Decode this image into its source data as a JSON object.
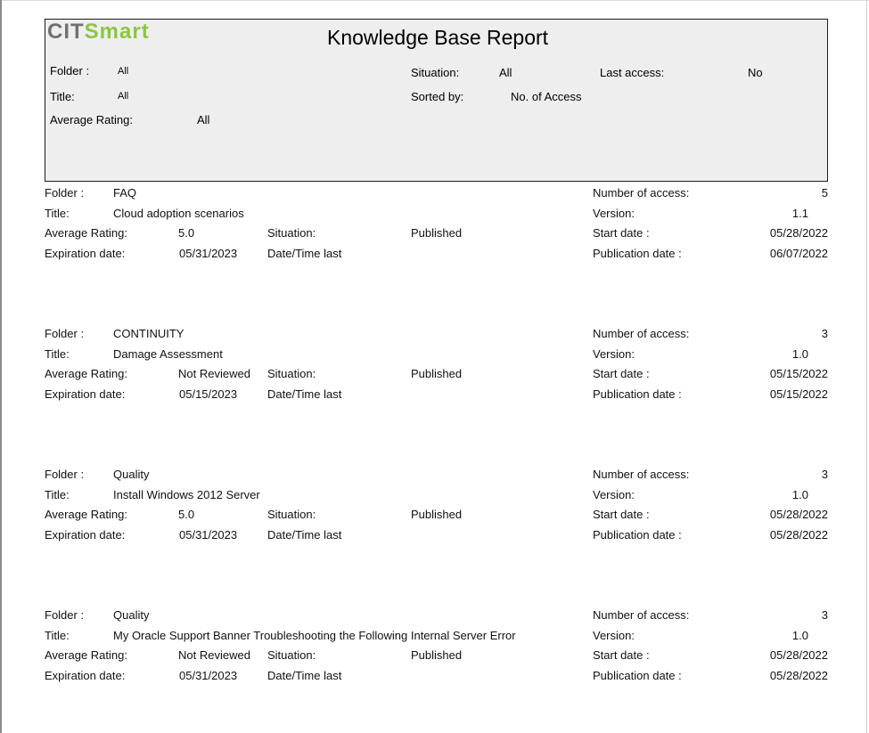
{
  "logo": {
    "part1": "CIT",
    "part2": "Smart"
  },
  "report_title": "Knowledge Base Report",
  "filters": {
    "folder_label": "Folder :",
    "folder_value": "All",
    "title_label": "Title:",
    "title_value": "All",
    "avg_label": "Average Rating:",
    "avg_value": "All",
    "situation_label": "Situation:",
    "situation_value": "All",
    "sorted_label": "Sorted by:",
    "sorted_value": "No. of Access",
    "last_access_label": "Last access:",
    "last_access_value": "No"
  },
  "labels": {
    "folder": "Folder :",
    "title": "Title:",
    "avg_rating": "Average Rating:",
    "situation": "Situation:",
    "expiration": "Expiration date:",
    "datetime_last": "Date/Time last",
    "number_access": "Number of access:",
    "version": "Version:",
    "start_date": "Start date :",
    "publication_date": "Publication date :"
  },
  "records": [
    {
      "folder": "FAQ",
      "title": "Cloud adoption scenarios",
      "avg_rating": "5.0",
      "situation": "Published",
      "expiration": "05/31/2023",
      "number_access": "5",
      "version": "1.1",
      "start_date": "05/28/2022",
      "publication_date": "06/07/2022"
    },
    {
      "folder": "CONTINUITY",
      "title": "Damage Assessment",
      "avg_rating": "Not Reviewed",
      "situation": "Published",
      "expiration": "05/15/2023",
      "number_access": "3",
      "version": "1.0",
      "start_date": "05/15/2022",
      "publication_date": "05/15/2022"
    },
    {
      "folder": "Quality",
      "title": "Install Windows 2012 Server",
      "avg_rating": "5.0",
      "situation": "Published",
      "expiration": "05/31/2023",
      "number_access": "3",
      "version": "1.0",
      "start_date": "05/28/2022",
      "publication_date": "05/28/2022"
    },
    {
      "folder": "Quality",
      "title": "My Oracle Support Banner Troubleshooting the Following Internal Server Error",
      "avg_rating": "Not Reviewed",
      "situation": "Published",
      "expiration": "05/31/2023",
      "number_access": "3",
      "version": "1.0",
      "start_date": "05/28/2022",
      "publication_date": "05/28/2022"
    }
  ]
}
